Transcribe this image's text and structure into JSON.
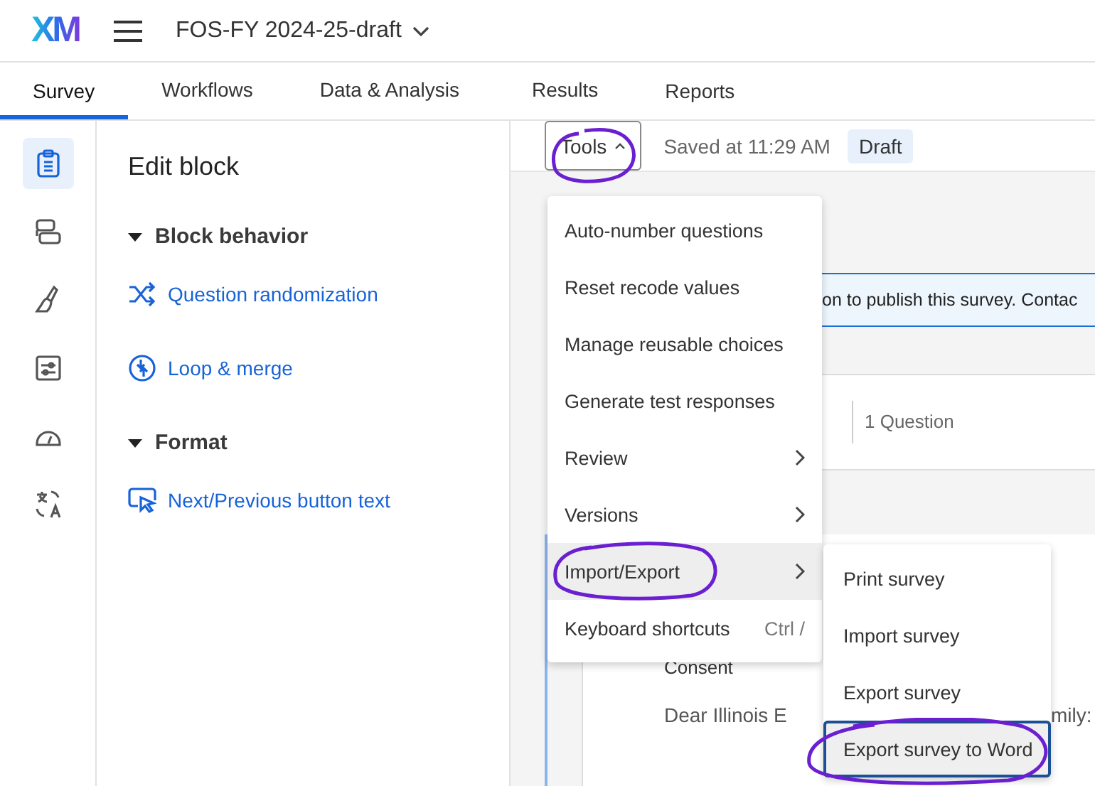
{
  "header": {
    "logo": "XM",
    "project_title": "FOS-FY 2024-25-draft"
  },
  "tabs": [
    {
      "label": "Survey",
      "selected": true
    },
    {
      "label": "Workflows",
      "selected": false
    },
    {
      "label": "Data & Analysis",
      "selected": false
    },
    {
      "label": "Results",
      "selected": false
    },
    {
      "label": "Reports",
      "selected": false
    }
  ],
  "rail": [
    {
      "kind": "clipboard",
      "selected": true
    },
    {
      "kind": "blocks",
      "selected": false
    },
    {
      "kind": "brush",
      "selected": false
    },
    {
      "kind": "sliders",
      "selected": false
    },
    {
      "kind": "gauge",
      "selected": false
    },
    {
      "kind": "translate",
      "selected": false
    }
  ],
  "panel": {
    "title": "Edit block",
    "sections": [
      {
        "title": "Block behavior",
        "expanded": true,
        "items": [
          {
            "kind": "shuffle",
            "label": "Question randomization"
          },
          {
            "kind": "loop",
            "label": "Loop & merge"
          }
        ]
      },
      {
        "title": "Format",
        "expanded": true,
        "items": [
          {
            "kind": "pointer",
            "label": "Next/Previous button text"
          }
        ]
      }
    ]
  },
  "toolbar": {
    "tools_button": "Tools",
    "saved": "Saved at 11:29 AM",
    "status": "Draft"
  },
  "banner": {
    "text": "on to publish this survey. Contac"
  },
  "block": {
    "count": "1 Question"
  },
  "question": {
    "label": "Consent",
    "text_start": "Dear Illinois E",
    "text_end": "mily:"
  },
  "tools_menu": [
    {
      "label": "Auto-number questions",
      "submenu": false,
      "selected": false
    },
    {
      "label": "Reset recode values",
      "submenu": false,
      "selected": false
    },
    {
      "label": "Manage reusable choices",
      "submenu": false,
      "selected": false
    },
    {
      "label": "Generate test responses",
      "submenu": false,
      "selected": false
    },
    {
      "label": "Review",
      "submenu": true,
      "selected": false
    },
    {
      "label": "Versions",
      "submenu": true,
      "selected": false
    },
    {
      "label": "Import/Export",
      "submenu": true,
      "selected": true
    },
    {
      "label": "Keyboard shortcuts",
      "shortcut": "Ctrl /",
      "submenu": false,
      "selected": false
    }
  ],
  "submenu": [
    {
      "label": "Print survey",
      "selected": false
    },
    {
      "label": "Import survey",
      "selected": false
    },
    {
      "label": "Export survey",
      "selected": false
    },
    {
      "label": "Export survey to Word",
      "selected": true
    }
  ]
}
